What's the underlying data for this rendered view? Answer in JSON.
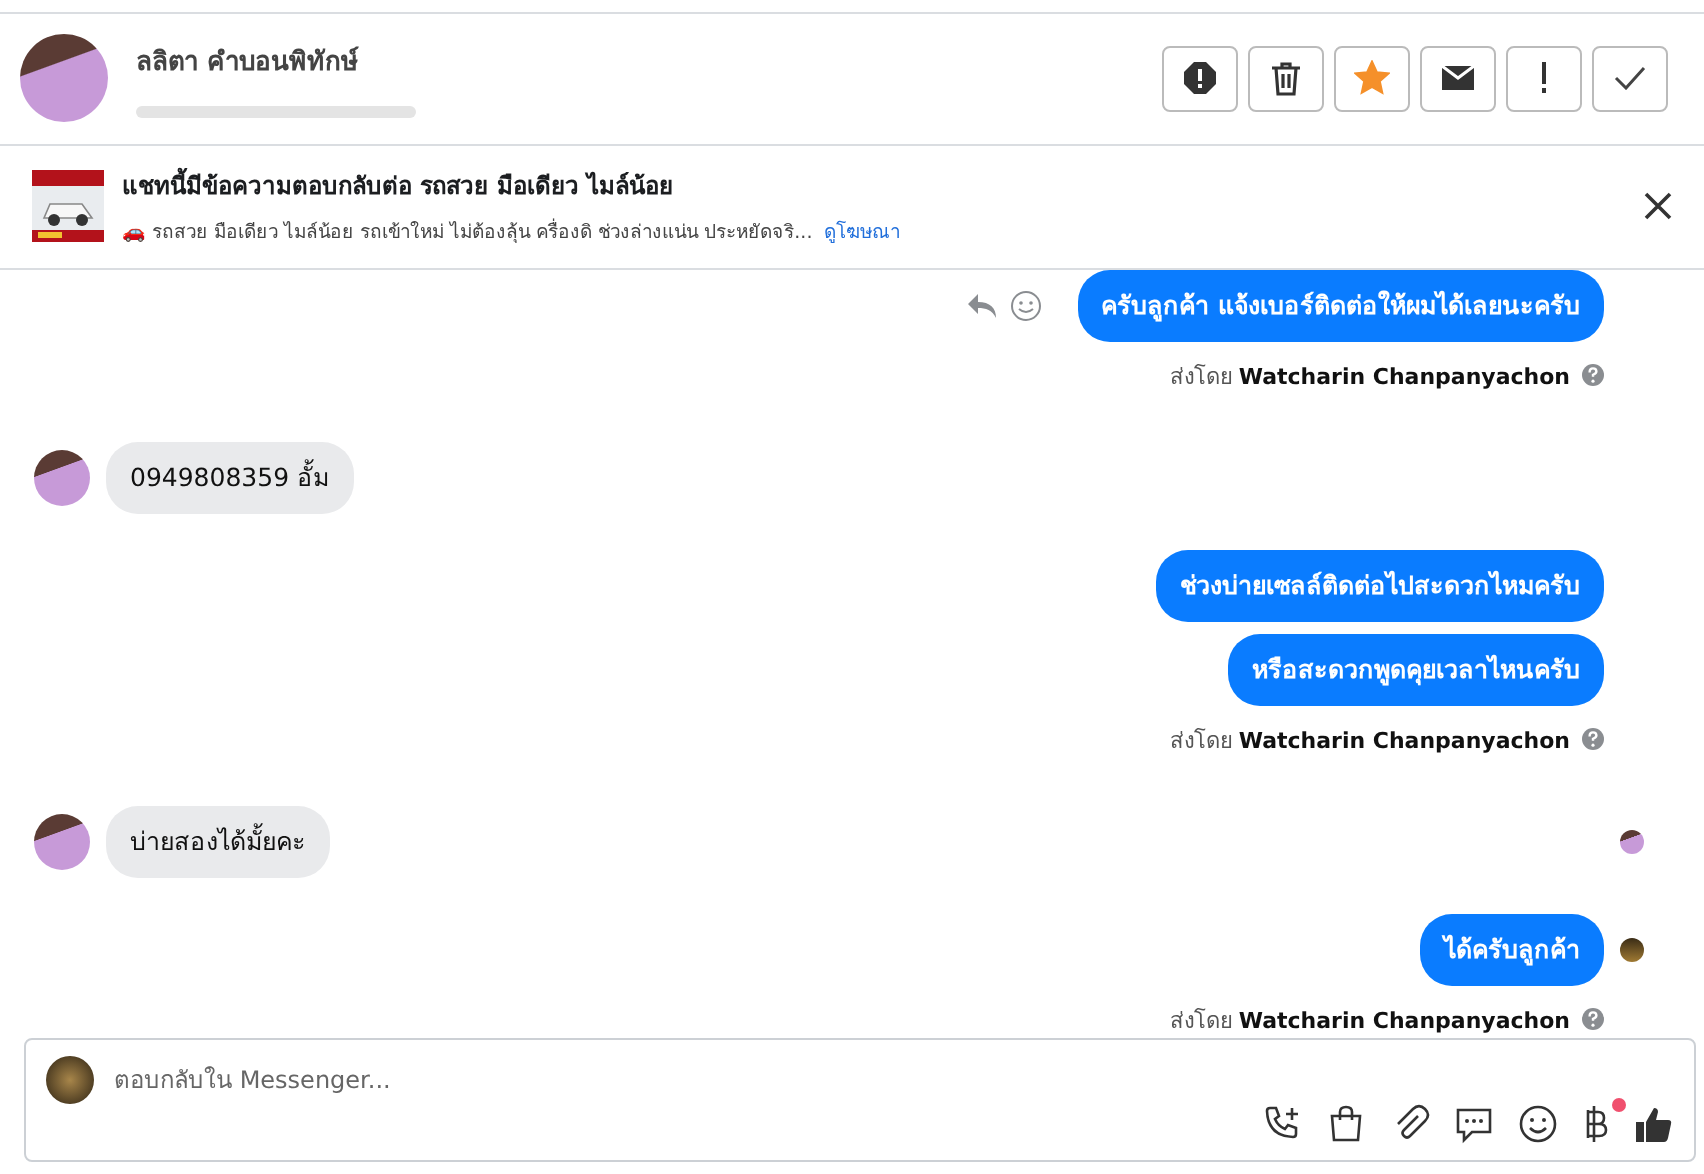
{
  "contact": {
    "name": "ลลิตา คำบอนพิทักษ์"
  },
  "actions": [
    {
      "kind": "spam"
    },
    {
      "kind": "delete"
    },
    {
      "kind": "star",
      "on": true
    },
    {
      "kind": "mail"
    },
    {
      "kind": "important"
    },
    {
      "kind": "done"
    }
  ],
  "ad": {
    "title": "แชทนี้มีข้อความตอบกลับต่อ รถสวย มือเดียว ไมล์น้อย",
    "text": "🚗 รถสวย มือเดียว ไมล์น้อย รถเข้าใหม่ ไม่ต้องลุ้น ครื่องดิ ช่วงล่างแน่น ประหยัดจริ...",
    "link": "ดูโฆษณา"
  },
  "messages": [
    {
      "kind": "outgoing",
      "text": "ครับลูกค้า แจ้งเบอร์ติดต่อให้ผมได้เลยนะครับ",
      "hover_actions": true,
      "seen": false
    },
    {
      "kind": "sender",
      "text": "ส่งโดย **Watcharin Chanpanyachon**"
    },
    {
      "kind": "incoming",
      "text": "0949808359  อั้ม",
      "seen": false
    },
    {
      "kind": "outgoing",
      "text": "ช่วงบ่ายเซลล์ติดต่อไปสะดวกไหมครับ",
      "hover_actions": false,
      "seen": false
    },
    {
      "kind": "outgoing",
      "text": "หรือสะดวกพูดคุยเวลาไหนครับ",
      "hover_actions": false,
      "seen": false
    },
    {
      "kind": "sender",
      "text": "ส่งโดย **Watcharin Chanpanyachon**"
    },
    {
      "kind": "incoming",
      "text": "บ่ายสองได้มั้ยคะ",
      "seen": true
    },
    {
      "kind": "outgoing",
      "text": "ได้ครับลูกค้า",
      "hover_actions": false,
      "seen": true
    },
    {
      "kind": "sender",
      "text": "ส่งโดย **Watcharin Chanpanyachon**"
    }
  ],
  "composer": {
    "placeholder": "ตอบกลับใน Messenger...",
    "payment_badge": true
  }
}
